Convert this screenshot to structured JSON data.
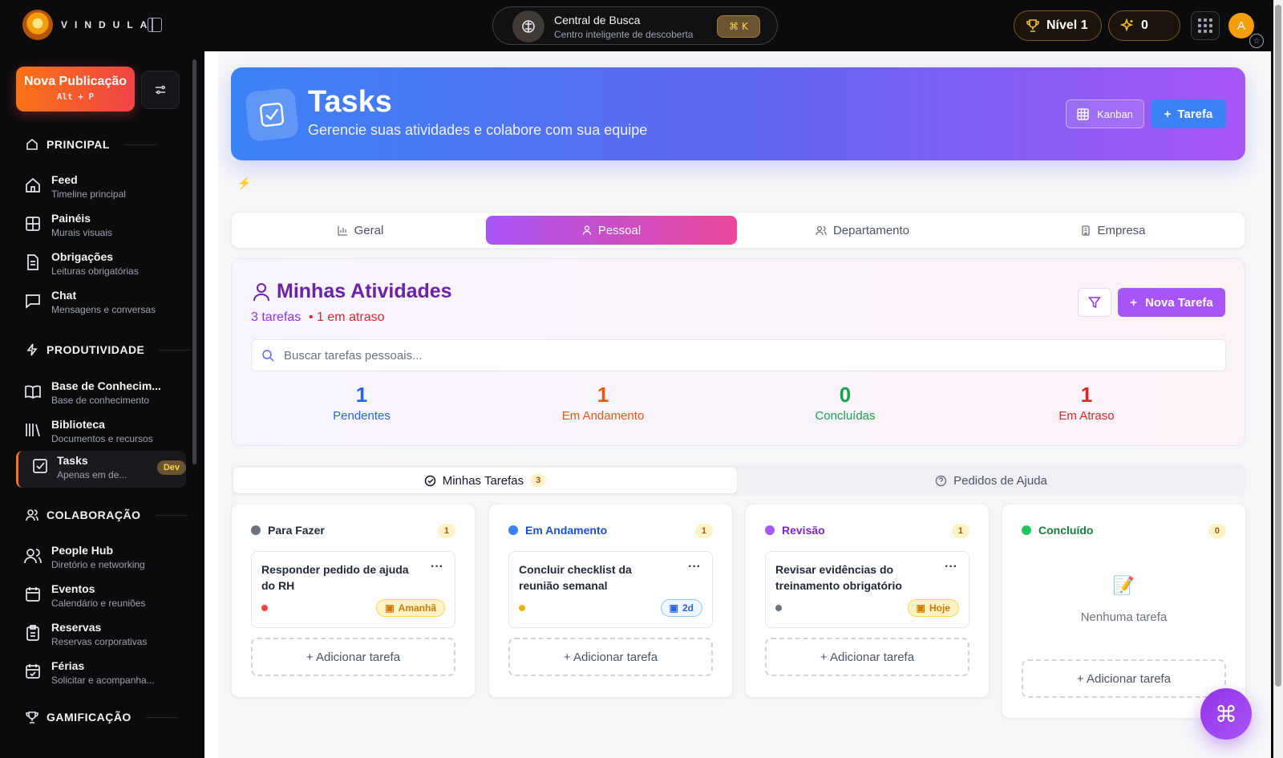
{
  "topbar": {
    "brand": "VINDULA",
    "search_title": "Central de Busca",
    "search_subtitle": "Centro inteligente de descoberta",
    "search_shortcut": "⌘ K",
    "level": "Nível 1",
    "points": "0",
    "avatar_initial": "A"
  },
  "sidebar": {
    "new_post_label": "Nova Publicação",
    "new_post_shortcut": "Alt + P",
    "sections": {
      "principal": "PRINCIPAL",
      "produtividade": "PRODUTIVIDADE",
      "colaboracao": "COLABORAÇÃO",
      "gamificacao": "GAMIFICAÇÃO"
    },
    "items": [
      {
        "label": "Feed",
        "sub": "Timeline principal",
        "icon": "home-icon"
      },
      {
        "label": "Painéis",
        "sub": "Murais visuais",
        "icon": "grid-icon"
      },
      {
        "label": "Obrigações",
        "sub": "Leituras obrigatórias",
        "icon": "document-icon"
      },
      {
        "label": "Chat",
        "sub": "Mensagens e conversas",
        "icon": "chat-icon"
      },
      {
        "label": "Base de Conhecim...",
        "sub": "Base de conhecimento",
        "icon": "book-icon"
      },
      {
        "label": "Biblioteca",
        "sub": "Documentos e recursos",
        "icon": "library-icon"
      },
      {
        "label": "Tasks",
        "sub": "Apenas em de...",
        "icon": "task-check-icon",
        "badge": "Dev"
      },
      {
        "label": "People Hub",
        "sub": "Diretório e networking",
        "icon": "users-icon"
      },
      {
        "label": "Eventos",
        "sub": "Calendário e reuniões",
        "icon": "calendar-icon"
      },
      {
        "label": "Reservas",
        "sub": "Reservas corporativas",
        "icon": "clipboard-icon"
      },
      {
        "label": "Férias",
        "sub": "Solicitar e acompanha...",
        "icon": "calendar-check-icon"
      }
    ]
  },
  "hero": {
    "title": "Tasks",
    "subtitle": "Gerencie suas atividades e colabore com sua equipe",
    "kanban_label": "Kanban",
    "new_task_label": "Tarefa"
  },
  "scope_tabs": [
    "Geral",
    "Pessoal",
    "Departamento",
    "Empresa"
  ],
  "activities": {
    "title": "Minhas Atividades",
    "count_text": "3 tarefas",
    "late_text": "• 1 em atraso",
    "new_task_label": "Nova Tarefa",
    "search_placeholder": "Buscar tarefas pessoais...",
    "stats": [
      {
        "value": "1",
        "label": "Pendentes",
        "color": "#2563eb"
      },
      {
        "value": "1",
        "label": "Em Andamento",
        "color": "#ea580c"
      },
      {
        "value": "0",
        "label": "Concluídas",
        "color": "#16a34a"
      },
      {
        "value": "1",
        "label": "Em Atraso",
        "color": "#dc2626"
      }
    ]
  },
  "task_tabs": {
    "mine_label": "Minhas Tarefas",
    "mine_count": "3",
    "help_label": "Pedidos de Ajuda"
  },
  "board": {
    "add_task_label": "+ Adicionar tarefa",
    "empty_icon": "📝",
    "empty_label": "Nenhuma tarefa",
    "columns": [
      {
        "title": "Para Fazer",
        "count": "1",
        "dot": "#6b7280",
        "title_color": "#1f2937",
        "card": {
          "title": "Responder pedido de ajuda do RH",
          "due": "Amanhã",
          "priority": "#ef4444",
          "due_style": "warn"
        }
      },
      {
        "title": "Em Andamento",
        "count": "1",
        "dot": "#3b82f6",
        "title_color": "#1d4ed8",
        "card": {
          "title": "Concluir checklist da reunião semanal",
          "due": "2d",
          "priority": "#eab308",
          "due_style": "info"
        }
      },
      {
        "title": "Revisão",
        "count": "1",
        "dot": "#a855f7",
        "title_color": "#7e22ce",
        "card": {
          "title": "Revisar evidências do treinamento obrigatório",
          "due": "Hoje",
          "priority": "#6b7280",
          "due_style": "warn"
        }
      },
      {
        "title": "Concluído",
        "count": "0",
        "dot": "#22c55e",
        "title_color": "#15803d"
      }
    ]
  },
  "fab_icon": "⌘"
}
